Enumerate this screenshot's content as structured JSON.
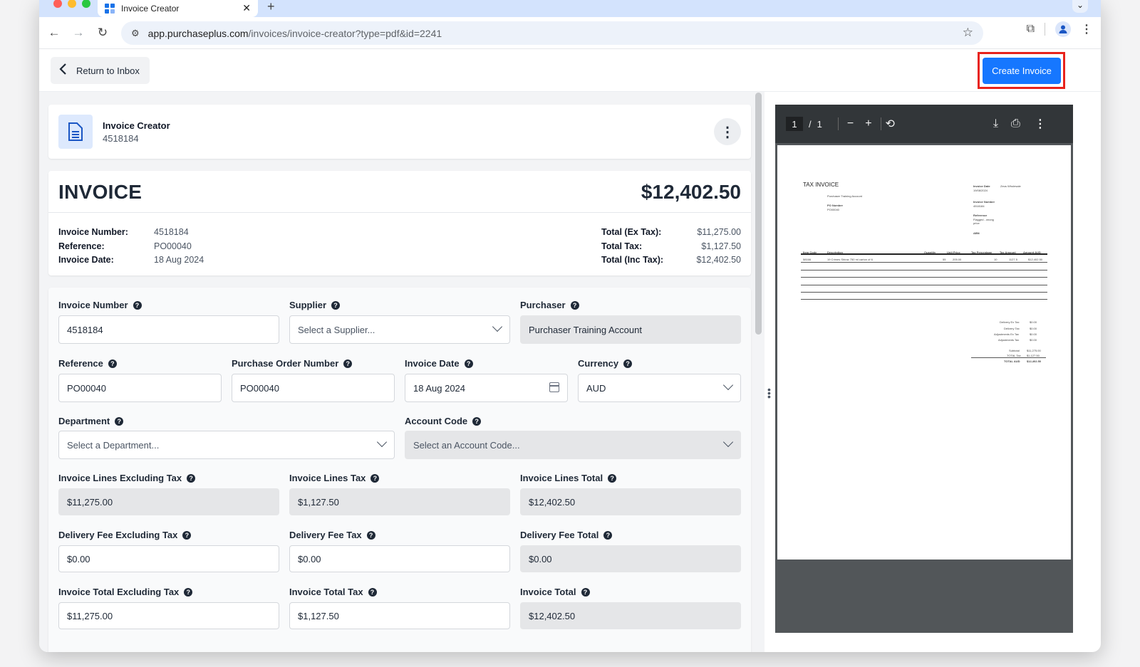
{
  "browser": {
    "tab_title": "Invoice Creator",
    "url_host": "app.purchaseplus.com",
    "url_path": "/invoices/invoice-creator?type=pdf&id=2241"
  },
  "header": {
    "return_label": "Return to Inbox",
    "create_label": "Create Invoice"
  },
  "creator_card": {
    "title": "Invoice Creator",
    "subtitle": "4518184"
  },
  "invoice": {
    "heading": "INVOICE",
    "total_display": "$12,402.50",
    "meta_left": [
      {
        "label": "Invoice Number:",
        "value": "4518184"
      },
      {
        "label": "Reference:",
        "value": "PO00040"
      },
      {
        "label": "Invoice Date:",
        "value": "18 Aug 2024"
      }
    ],
    "meta_right": [
      {
        "label": "Total (Ex Tax):",
        "value": "$11,275.00"
      },
      {
        "label": "Total Tax:",
        "value": "$1,127.50"
      },
      {
        "label": "Total (Inc Tax):",
        "value": "$12,402.50"
      }
    ]
  },
  "form": {
    "invoice_number": {
      "label": "Invoice Number",
      "value": "4518184"
    },
    "supplier": {
      "label": "Supplier",
      "placeholder": "Select a Supplier..."
    },
    "purchaser": {
      "label": "Purchaser",
      "value": "Purchaser Training Account"
    },
    "reference": {
      "label": "Reference",
      "value": "PO00040"
    },
    "po_number": {
      "label": "Purchase Order Number",
      "value": "PO00040"
    },
    "invoice_date": {
      "label": "Invoice Date",
      "value": "18 Aug 2024"
    },
    "currency": {
      "label": "Currency",
      "value": "AUD"
    },
    "department": {
      "label": "Department",
      "placeholder": "Select a Department..."
    },
    "account_code": {
      "label": "Account Code",
      "placeholder": "Select an Account Code..."
    },
    "lines_ex_tax": {
      "label": "Invoice Lines Excluding Tax",
      "value": "$11,275.00"
    },
    "lines_tax": {
      "label": "Invoice Lines Tax",
      "value": "$1,127.50"
    },
    "lines_total": {
      "label": "Invoice Lines Total",
      "value": "$12,402.50"
    },
    "delivery_ex_tax": {
      "label": "Delivery Fee Excluding Tax",
      "value": "$0.00"
    },
    "delivery_tax": {
      "label": "Delivery Fee Tax",
      "value": "$0.00"
    },
    "delivery_total": {
      "label": "Delivery Fee Total",
      "value": "$0.00"
    },
    "total_ex_tax": {
      "label": "Invoice Total Excluding Tax",
      "value": "$11,275.00"
    },
    "total_tax": {
      "label": "Invoice Total Tax",
      "value": "$1,127.50"
    },
    "total": {
      "label": "Invoice Total",
      "value": "$12,402.50"
    }
  },
  "pdf_viewer": {
    "page_current": "1",
    "page_total": "1",
    "page": {
      "heading": "TAX INVOICE",
      "purchaser": "Purchaser Training Account",
      "po_label": "PO Number",
      "po_value": "PO00040",
      "invoice_date_label": "Invoice Date",
      "invoice_date_value": "19/08/2024",
      "supplier": "Zeus Wholesale",
      "invoice_number_label": "Invoice Number",
      "invoice_number_value": "4518184",
      "reference_label": "Reference",
      "reference_value": "Flagged - wrong price",
      "abn_label": "ABN",
      "columns": [
        "Item Code",
        "Description",
        "Quantity",
        "Unit Price",
        "Tax Percentage",
        "Tax Amount",
        "Amount AUD"
      ],
      "row": [
        "58166",
        "19 Crimes Shiraz 750 ml carton of 6",
        "55",
        "205.00",
        "10",
        "1127.5",
        "$12,402.50"
      ],
      "summary": [
        {
          "label": "Delivery Ex Tax",
          "value": "$0.00"
        },
        {
          "label": "Delivery Tax",
          "value": "$0.00"
        },
        {
          "label": "Adjustments Ex Tax",
          "value": "$0.00"
        },
        {
          "label": "Adjustments Tax",
          "value": "$0.00"
        },
        {
          "label": "Subtotal",
          "value": "$11,275.00"
        },
        {
          "label": "TOTAL Tax",
          "value": "$1,127.50"
        },
        {
          "label": "TOTAL AUD",
          "value": "$12,402.50"
        }
      ]
    }
  },
  "colors": {
    "primary": "#1677ff",
    "highlight": "#e8231c",
    "pdf_toolbar": "#323639"
  }
}
